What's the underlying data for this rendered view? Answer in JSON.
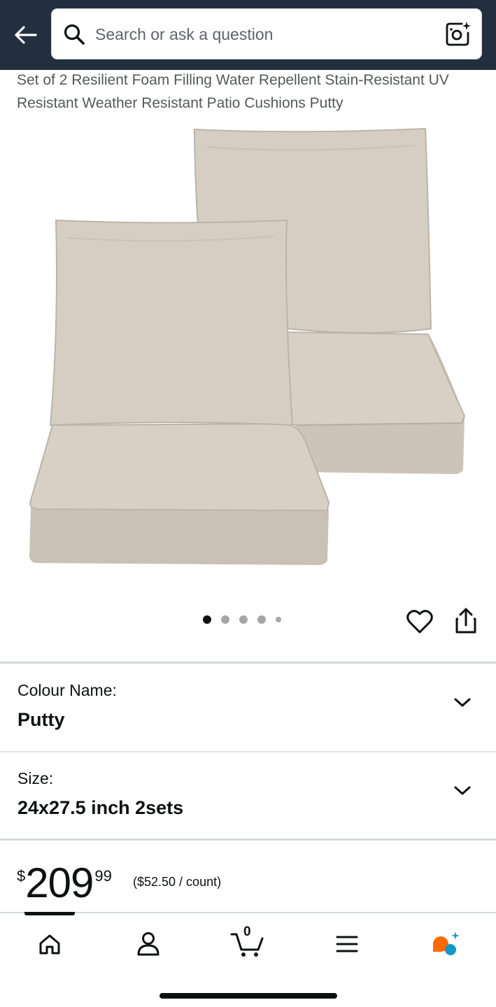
{
  "header": {
    "search_placeholder": "Search or ask a question"
  },
  "product": {
    "title": "Set of 2 Resilient Foam Filling Water Repellent Stain-Resistant UV Resistant Weather Resistant Patio Cushions Putty",
    "image_count": 5,
    "active_image_index": 0
  },
  "options": {
    "colour": {
      "label": "Colour Name:",
      "value": "Putty"
    },
    "size": {
      "label": "Size:",
      "value": "24x27.5 inch 2sets"
    }
  },
  "price": {
    "currency": "$",
    "whole": "209",
    "fraction": "99",
    "unit_price": "($52.50 / count)"
  },
  "nav": {
    "cart_count": "0",
    "items": [
      "home-icon",
      "account-icon",
      "cart-icon",
      "menu-icon",
      "assistant-icon"
    ]
  },
  "colors": {
    "header_bg": "#232f3e",
    "text": "#0f1111",
    "muted_text": "#565959",
    "assistant_orange": "#ff6a00",
    "assistant_teal": "#1399c6"
  }
}
